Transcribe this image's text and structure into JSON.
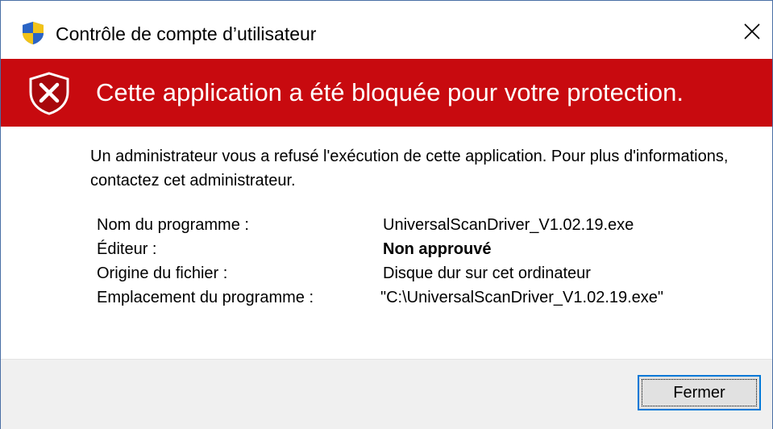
{
  "window": {
    "title": "Contrôle de compte d’utilisateur",
    "title_icon": "uac-shield-icon",
    "close_icon": "close-icon"
  },
  "banner": {
    "text": "Cette application a été bloquée pour votre protection.",
    "icon": "blocked-shield-icon",
    "color": "#c80a0f"
  },
  "message": "Un administrateur vous a refusé l'exécution de cette application. Pour plus d'informations, contactez cet administrateur.",
  "details": [
    {
      "label": "Nom du programme :",
      "value": "UniversalScanDriver_V1.02.19.exe"
    },
    {
      "label": "Éditeur :",
      "value": "Non approuvé"
    },
    {
      "label": "Origine du fichier :",
      "value": "Disque dur sur cet ordinateur"
    },
    {
      "label": "Emplacement du programme :",
      "value": "\"C:\\UniversalScanDriver_V1.02.19.exe\""
    }
  ],
  "footer": {
    "close_button_label": "Fermer"
  }
}
